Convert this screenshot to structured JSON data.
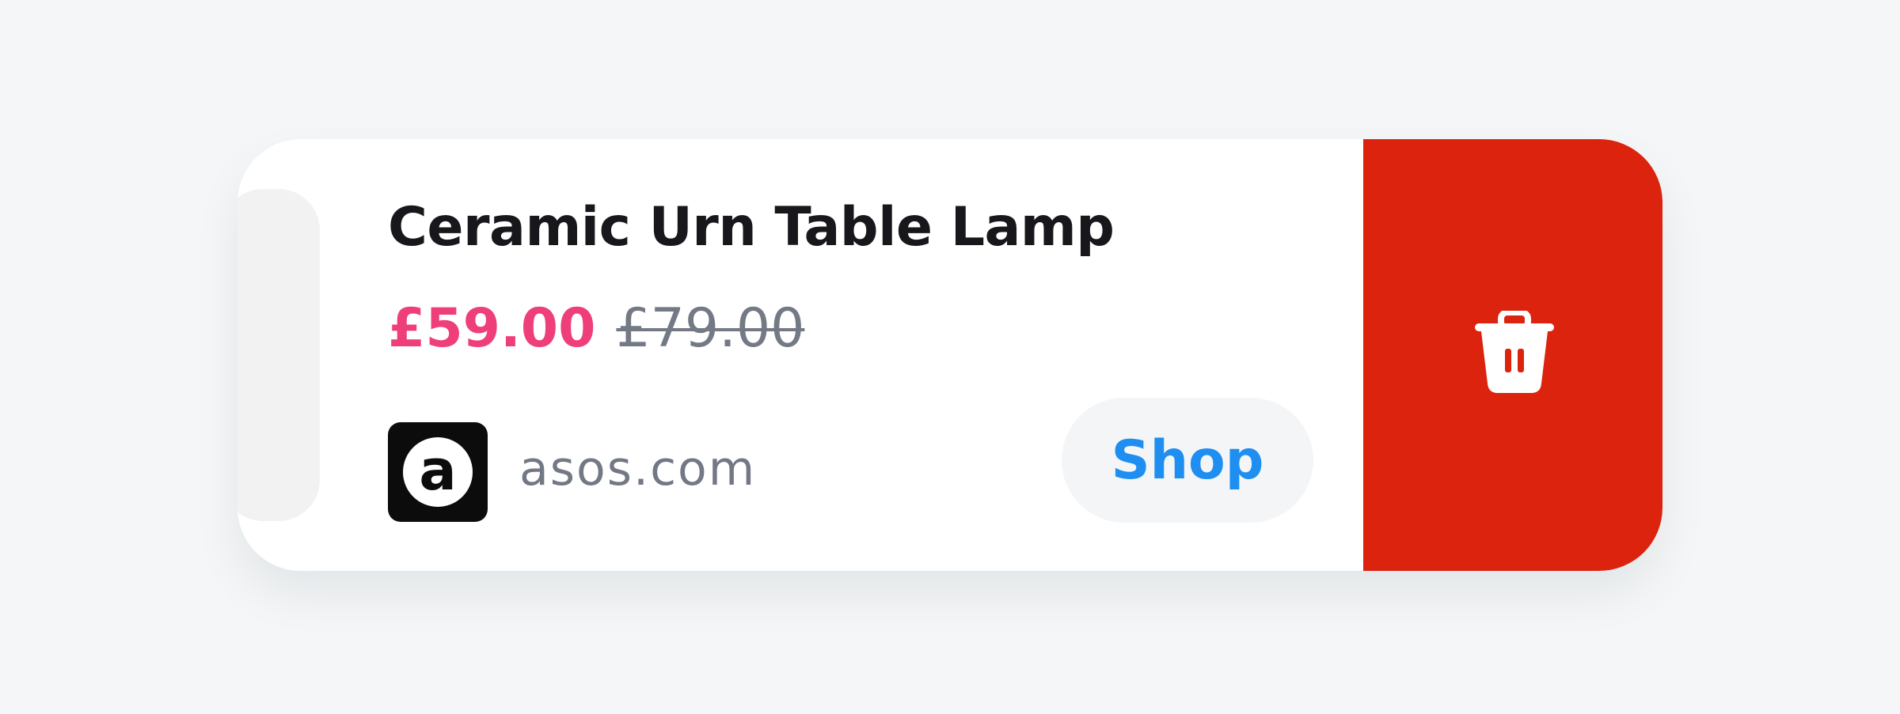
{
  "product": {
    "title": "Ceramic Urn Table Lamp",
    "sale_price": "£59.00",
    "original_price": "£79.00"
  },
  "store": {
    "logo_letter": "a",
    "name": "asos.com"
  },
  "actions": {
    "shop_label": "Shop",
    "delete_icon": "trash-icon"
  },
  "colors": {
    "page_background": "#f4f6f7",
    "sale_price": "#ee3f7b",
    "original_price": "#737985",
    "shop_button_text": "#1f8ef1",
    "delete_background": "#db230d"
  }
}
